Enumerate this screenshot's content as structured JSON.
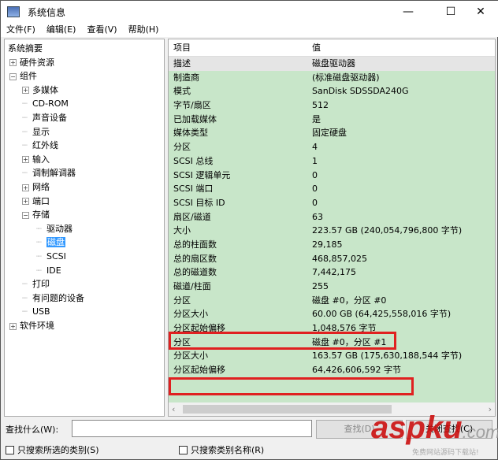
{
  "window": {
    "title": "系统信息",
    "minimize": "—",
    "maximize": "☐",
    "close": "✕"
  },
  "menu": [
    "文件(F)",
    "编辑(E)",
    "查看(V)",
    "帮助(H)"
  ],
  "tree": [
    {
      "label": "系统摘要",
      "level": 0,
      "exp": ""
    },
    {
      "label": "硬件资源",
      "level": 1,
      "exp": "+"
    },
    {
      "label": "组件",
      "level": 1,
      "exp": "-"
    },
    {
      "label": "多媒体",
      "level": 2,
      "exp": "+"
    },
    {
      "label": "CD-ROM",
      "level": 2,
      "exp": ""
    },
    {
      "label": "声音设备",
      "level": 2,
      "exp": ""
    },
    {
      "label": "显示",
      "level": 2,
      "exp": ""
    },
    {
      "label": "红外线",
      "level": 2,
      "exp": ""
    },
    {
      "label": "输入",
      "level": 2,
      "exp": "+"
    },
    {
      "label": "调制解调器",
      "level": 2,
      "exp": ""
    },
    {
      "label": "网络",
      "level": 2,
      "exp": "+"
    },
    {
      "label": "端口",
      "level": 2,
      "exp": "+"
    },
    {
      "label": "存储",
      "level": 2,
      "exp": "-"
    },
    {
      "label": "驱动器",
      "level": 3,
      "exp": ""
    },
    {
      "label": "磁盘",
      "level": 3,
      "exp": "",
      "selected": true
    },
    {
      "label": "SCSI",
      "level": 3,
      "exp": ""
    },
    {
      "label": "IDE",
      "level": 3,
      "exp": ""
    },
    {
      "label": "打印",
      "level": 2,
      "exp": ""
    },
    {
      "label": "有问题的设备",
      "level": 2,
      "exp": ""
    },
    {
      "label": "USB",
      "level": 2,
      "exp": ""
    },
    {
      "label": "软件环境",
      "level": 1,
      "exp": "+"
    }
  ],
  "table": {
    "headers": [
      "项目",
      "值"
    ],
    "rows": [
      [
        "描述",
        "磁盘驱动器"
      ],
      [
        "制造商",
        "(标准磁盘驱动器)"
      ],
      [
        "模式",
        "SanDisk SDSSDA240G"
      ],
      [
        "字节/扇区",
        "512"
      ],
      [
        "已加载媒体",
        "是"
      ],
      [
        "媒体类型",
        "固定硬盘"
      ],
      [
        "分区",
        "4"
      ],
      [
        "SCSI 总线",
        "1"
      ],
      [
        "SCSI 逻辑单元",
        "0"
      ],
      [
        "SCSI 端口",
        "0"
      ],
      [
        "SCSI 目标 ID",
        "0"
      ],
      [
        "扇区/磁道",
        "63"
      ],
      [
        "大小",
        "223.57 GB (240,054,796,800 字节)"
      ],
      [
        "总的柱面数",
        "29,185"
      ],
      [
        "总的扇区数",
        "468,857,025"
      ],
      [
        "总的磁道数",
        "7,442,175"
      ],
      [
        "磁道/柱面",
        "255"
      ],
      [
        "分区",
        "磁盘 #0，分区 #0"
      ],
      [
        "分区大小",
        "60.00 GB (64,425,558,016 字节)"
      ],
      [
        "分区起始偏移",
        "1,048,576 字节"
      ],
      [
        "分区",
        "磁盘 #0，分区 #1"
      ],
      [
        "分区大小",
        "163.57 GB (175,630,188,544 字节)"
      ],
      [
        "分区起始偏移",
        "64,426,606,592 字节"
      ]
    ]
  },
  "find": {
    "label": "查找什么(W):",
    "value": "",
    "find_button": "查找(D)",
    "close_button": "关闭查找(C)",
    "only_selected": "只搜索所选的类别(S)",
    "only_names": "只搜索类别名称(R)"
  },
  "watermark": {
    "text": "aspku",
    "suffix": ".com",
    "sub": "免费网站源码下载站!"
  }
}
